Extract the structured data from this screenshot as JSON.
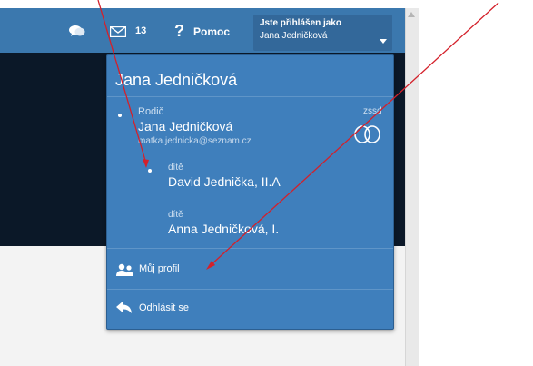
{
  "topbar": {
    "chat_icon": "chat-bubble-icon",
    "mail_icon": "envelope-icon",
    "message_count": "13",
    "help_icon": "question-icon",
    "help_label": "Pomoc",
    "logged_in_title": "Jste přihlášen jako",
    "logged_in_name": "Jana Jedničková"
  },
  "menu": {
    "header_name": "Jana Jedničková",
    "parent_role": "Rodič",
    "parent_name": "Jana Jedničková",
    "parent_email": "matka.jednicka@seznam.cz",
    "parent_tag": "zssd",
    "children": [
      {
        "role": "dítě",
        "name": "David Jednička, II.A"
      },
      {
        "role": "dítě",
        "name": "Anna Jedničková, I."
      }
    ],
    "profile_label": "Můj profil",
    "logout_label": "Odhlásit se"
  },
  "colors": {
    "topbar": "#3b78ae",
    "menu_bg": "#3f7fbc",
    "arrow": "#d4202a",
    "dark_band": "#0b1828"
  }
}
